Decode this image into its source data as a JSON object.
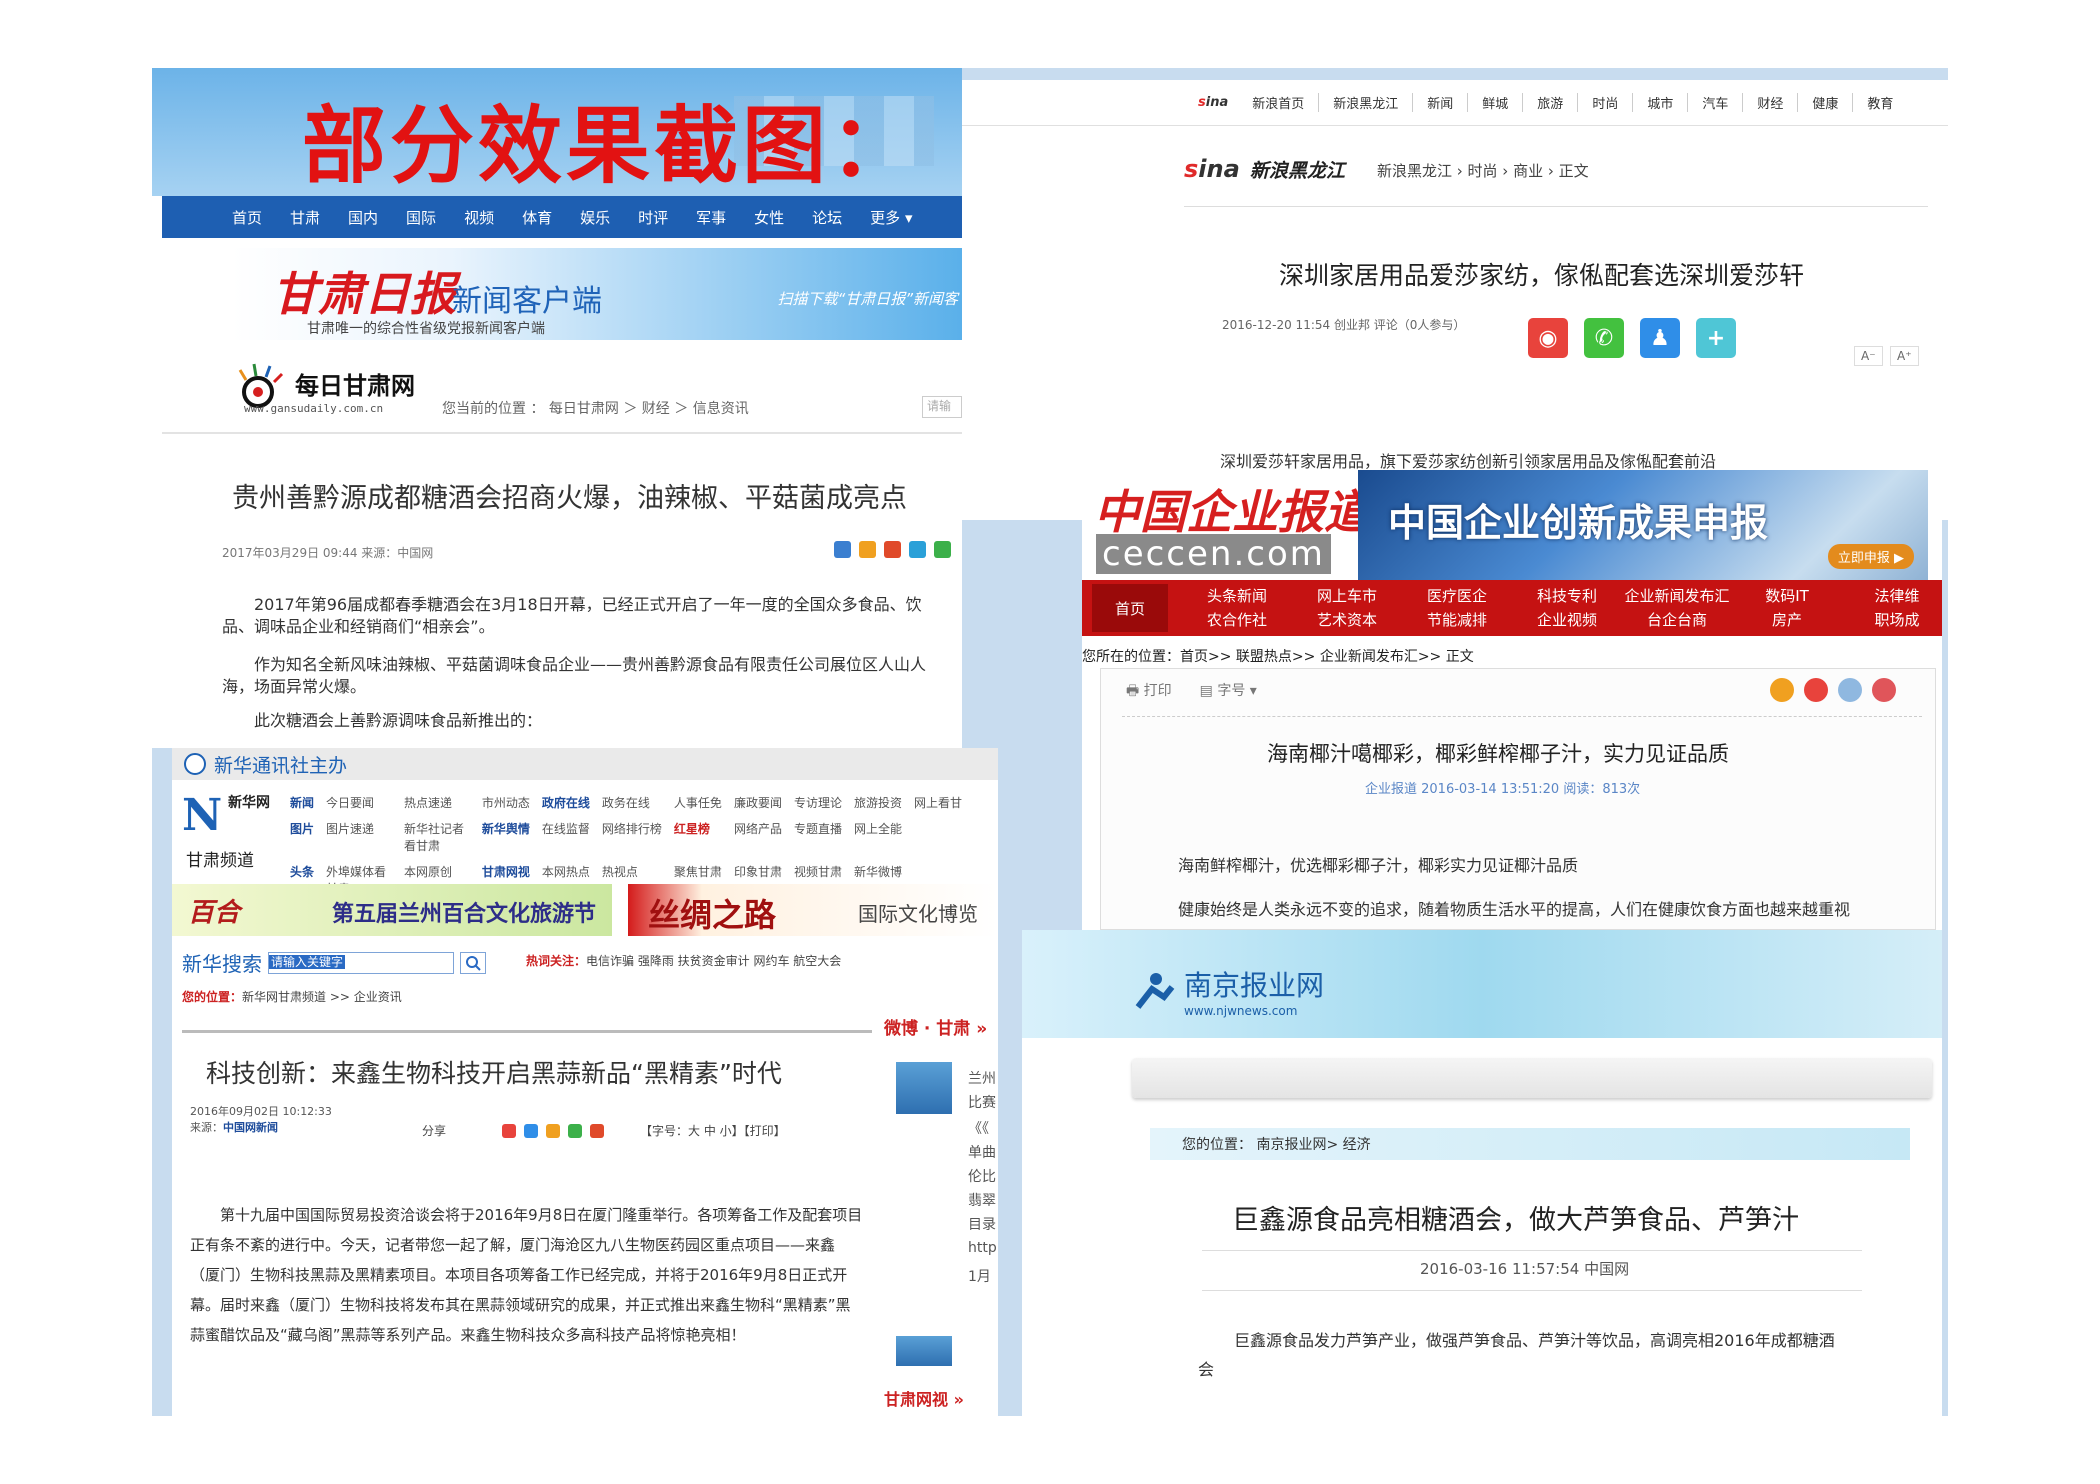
{
  "hero": {
    "title": "部分效果截图："
  },
  "gansu": {
    "nav": [
      "首页",
      "甘肃",
      "国内",
      "国际",
      "视频",
      "体育",
      "娱乐",
      "时评",
      "军事",
      "女性",
      "论坛",
      "更多 ▾"
    ],
    "banner_brand": "甘肃日报",
    "banner_app": "新闻客户端",
    "banner_slogan": "甘肃唯一的综合性省级党报新闻客户端",
    "banner_right": "扫描下载“甘肃日报”新闻客",
    "logo_name": "每日甘肃网",
    "logo_url": "www.gansudaily.com.cn",
    "crumb": "您当前的位置 ： 每日甘肃网 ＞ 财经 ＞ 信息资讯",
    "search_ph": "请输",
    "title": "贵州善黔源成都糖酒会招商火爆，油辣椒、平菇菌成亮点",
    "meta": "2017年03月29日 09:44  来源：中国网",
    "p1": "2017年第96届成都春季糖酒会在3月18日开幕，已经正式开启了一年一度的全国众多食品、饮品、调味品企业和经销商们“相亲会”。",
    "p2": "作为知名全新风味油辣椒、平菇菌调味食品企业——贵州善黔源食品有限责任公司展位区人山人海，场面异常火爆。",
    "p3": "此次糖酒会上善黔源调味食品新推出的："
  },
  "sina": {
    "logo": "sina",
    "brand": "新浪黑龙江",
    "nav": [
      "新浪首页",
      "新浪黑龙江",
      "新闻",
      "鲜城",
      "旅游",
      "时尚",
      "城市",
      "汽车",
      "财经",
      "健康",
      "教育"
    ],
    "crumb": "新浪黑龙江 › 时尚 › 商业 › 正文",
    "title": "深圳家居用品爱莎家纺，傢俬配套选深圳爱莎轩",
    "meta": "2016-12-20 11:54  创业邦    评论（0人参与）",
    "font_small": "A⁻",
    "font_big": "A⁺",
    "lead": "深圳爱莎轩家居用品，旗下爱莎家纺创新引领家居用品及傢俬配套前沿"
  },
  "ceccen": {
    "logo": "中国企业报道",
    "url": "ceccen.com",
    "banner": "中国企业创新成果申报",
    "banner_btn": "立即申报 ▶",
    "home": "首页",
    "nav": [
      "头条新闻",
      "网上车市",
      "医疗医企",
      "科技专利",
      "企业新闻发布汇",
      "数码IT",
      "法律维",
      "农合作社",
      "艺术资本",
      "节能减排",
      "企业视频",
      "台企台商",
      "房产",
      "职场成"
    ],
    "crumb": "您所在的位置：首页>> 联盟热点>> 企业新闻发布汇>> 正文",
    "print": "打印",
    "fontsize": "字号 ▾",
    "title": "海南椰汁噶椰彩，椰彩鲜榨椰子汁，实力见证品质",
    "meta": "企业报道    2016-03-14  13:51:20  阅读：813次",
    "p1": "海南鲜榨椰汁，优选椰彩椰子汁，椰彩实力见证椰汁品质",
    "p2": "健康始终是人类永远不变的追求，随着物质生活水平的提高，人们在健康饮食方面也越来越重视"
  },
  "xinhua": {
    "bar": "新华通讯社主办",
    "logo": "N",
    "logo_sub": "新华网",
    "channel": "甘肃频道",
    "links": [
      "新闻",
      "今日要闻",
      "热点速递",
      "市州动态",
      "政府在线",
      "政务在线",
      "人事任免",
      "廉政要闻",
      "专访理论",
      "旅游投资",
      "网上看甘",
      "图片",
      "图片速递",
      "新华社记者看甘肃",
      "新华舆情",
      "在线监督",
      "网络排行榜",
      "红星榜",
      "网络产品",
      "专题直播",
      "网上全能",
      "头条",
      "外埠媒体看甘肃",
      "本网原创",
      "甘肃网视",
      "本网热点",
      "热视点",
      "聚焦甘肃",
      "印象甘肃",
      "视频甘肃",
      "新华微博"
    ],
    "ban1": "百合",
    "ban1_t": "第五届兰州百合文化旅游节",
    "ban2": "丝绸之路",
    "ban2_t": "国际文化博览",
    "search_label": "新华搜索",
    "search_ph": "请输入关键字",
    "hot_label": "热词关注：",
    "hot": "电信诈骗  强降雨  扶贫资金审计  网约车  航空大会",
    "pos_label": "您的位置：",
    "pos": "新华网甘肃频道 >> 企业资讯",
    "side_head": "微博 · 甘肃 »",
    "title": "科技创新：来鑫生物科技开启黑蒜新品“黑精素”时代",
    "date": "2016年09月02日 10:12:33",
    "src_label": "来源：",
    "src": "中国网新闻",
    "share": "分享",
    "fontctl": "【字号：大 中 小】【打印】",
    "p": "第十九届中国国际贸易投资洽谈会将于2016年9月8日在厦门隆重举行。各项筹备工作及配套项目正有条不紊的进行中。今天，记者带您一起了解，厦门海沧区九八生物医药园区重点项目——来鑫（厦门）生物科技黑蒜及黑精素项目。本项目各项筹备工作已经完成，并将于2016年9月8日正式开幕。届时来鑫（厦门）生物科技将发布其在黑蒜领域研究的成果，并正式推出来鑫生物科“黑精素”黑蒜蜜醋饮品及“藏乌阁”黑蒜等系列产品。来鑫生物科技众多高科技产品将惊艳亮相！",
    "side": [
      "兰州",
      "比赛",
      "《《",
      "单曲",
      "伦比",
      "翡翠",
      "目录",
      "http",
      "1月"
    ],
    "foot": "甘肃网视 »"
  },
  "njw": {
    "logo": "南京报业网",
    "url": "www.njwnews.com",
    "crumb": "您的位置：  南京报业网>  经济",
    "title": "巨鑫源食品亮相糖酒会，做大芦笋食品、芦笋汁",
    "meta": "2016-03-16 11:57:54   中国网",
    "p": "巨鑫源食品发力芦笋产业，做强芦笋食品、芦笋汁等饮品，高调亮相2016年成都糖酒",
    "p2": "会"
  },
  "colors": {
    "red": "#e21212",
    "blue": "#1e5fb2",
    "ceccen_red": "#c51212"
  }
}
